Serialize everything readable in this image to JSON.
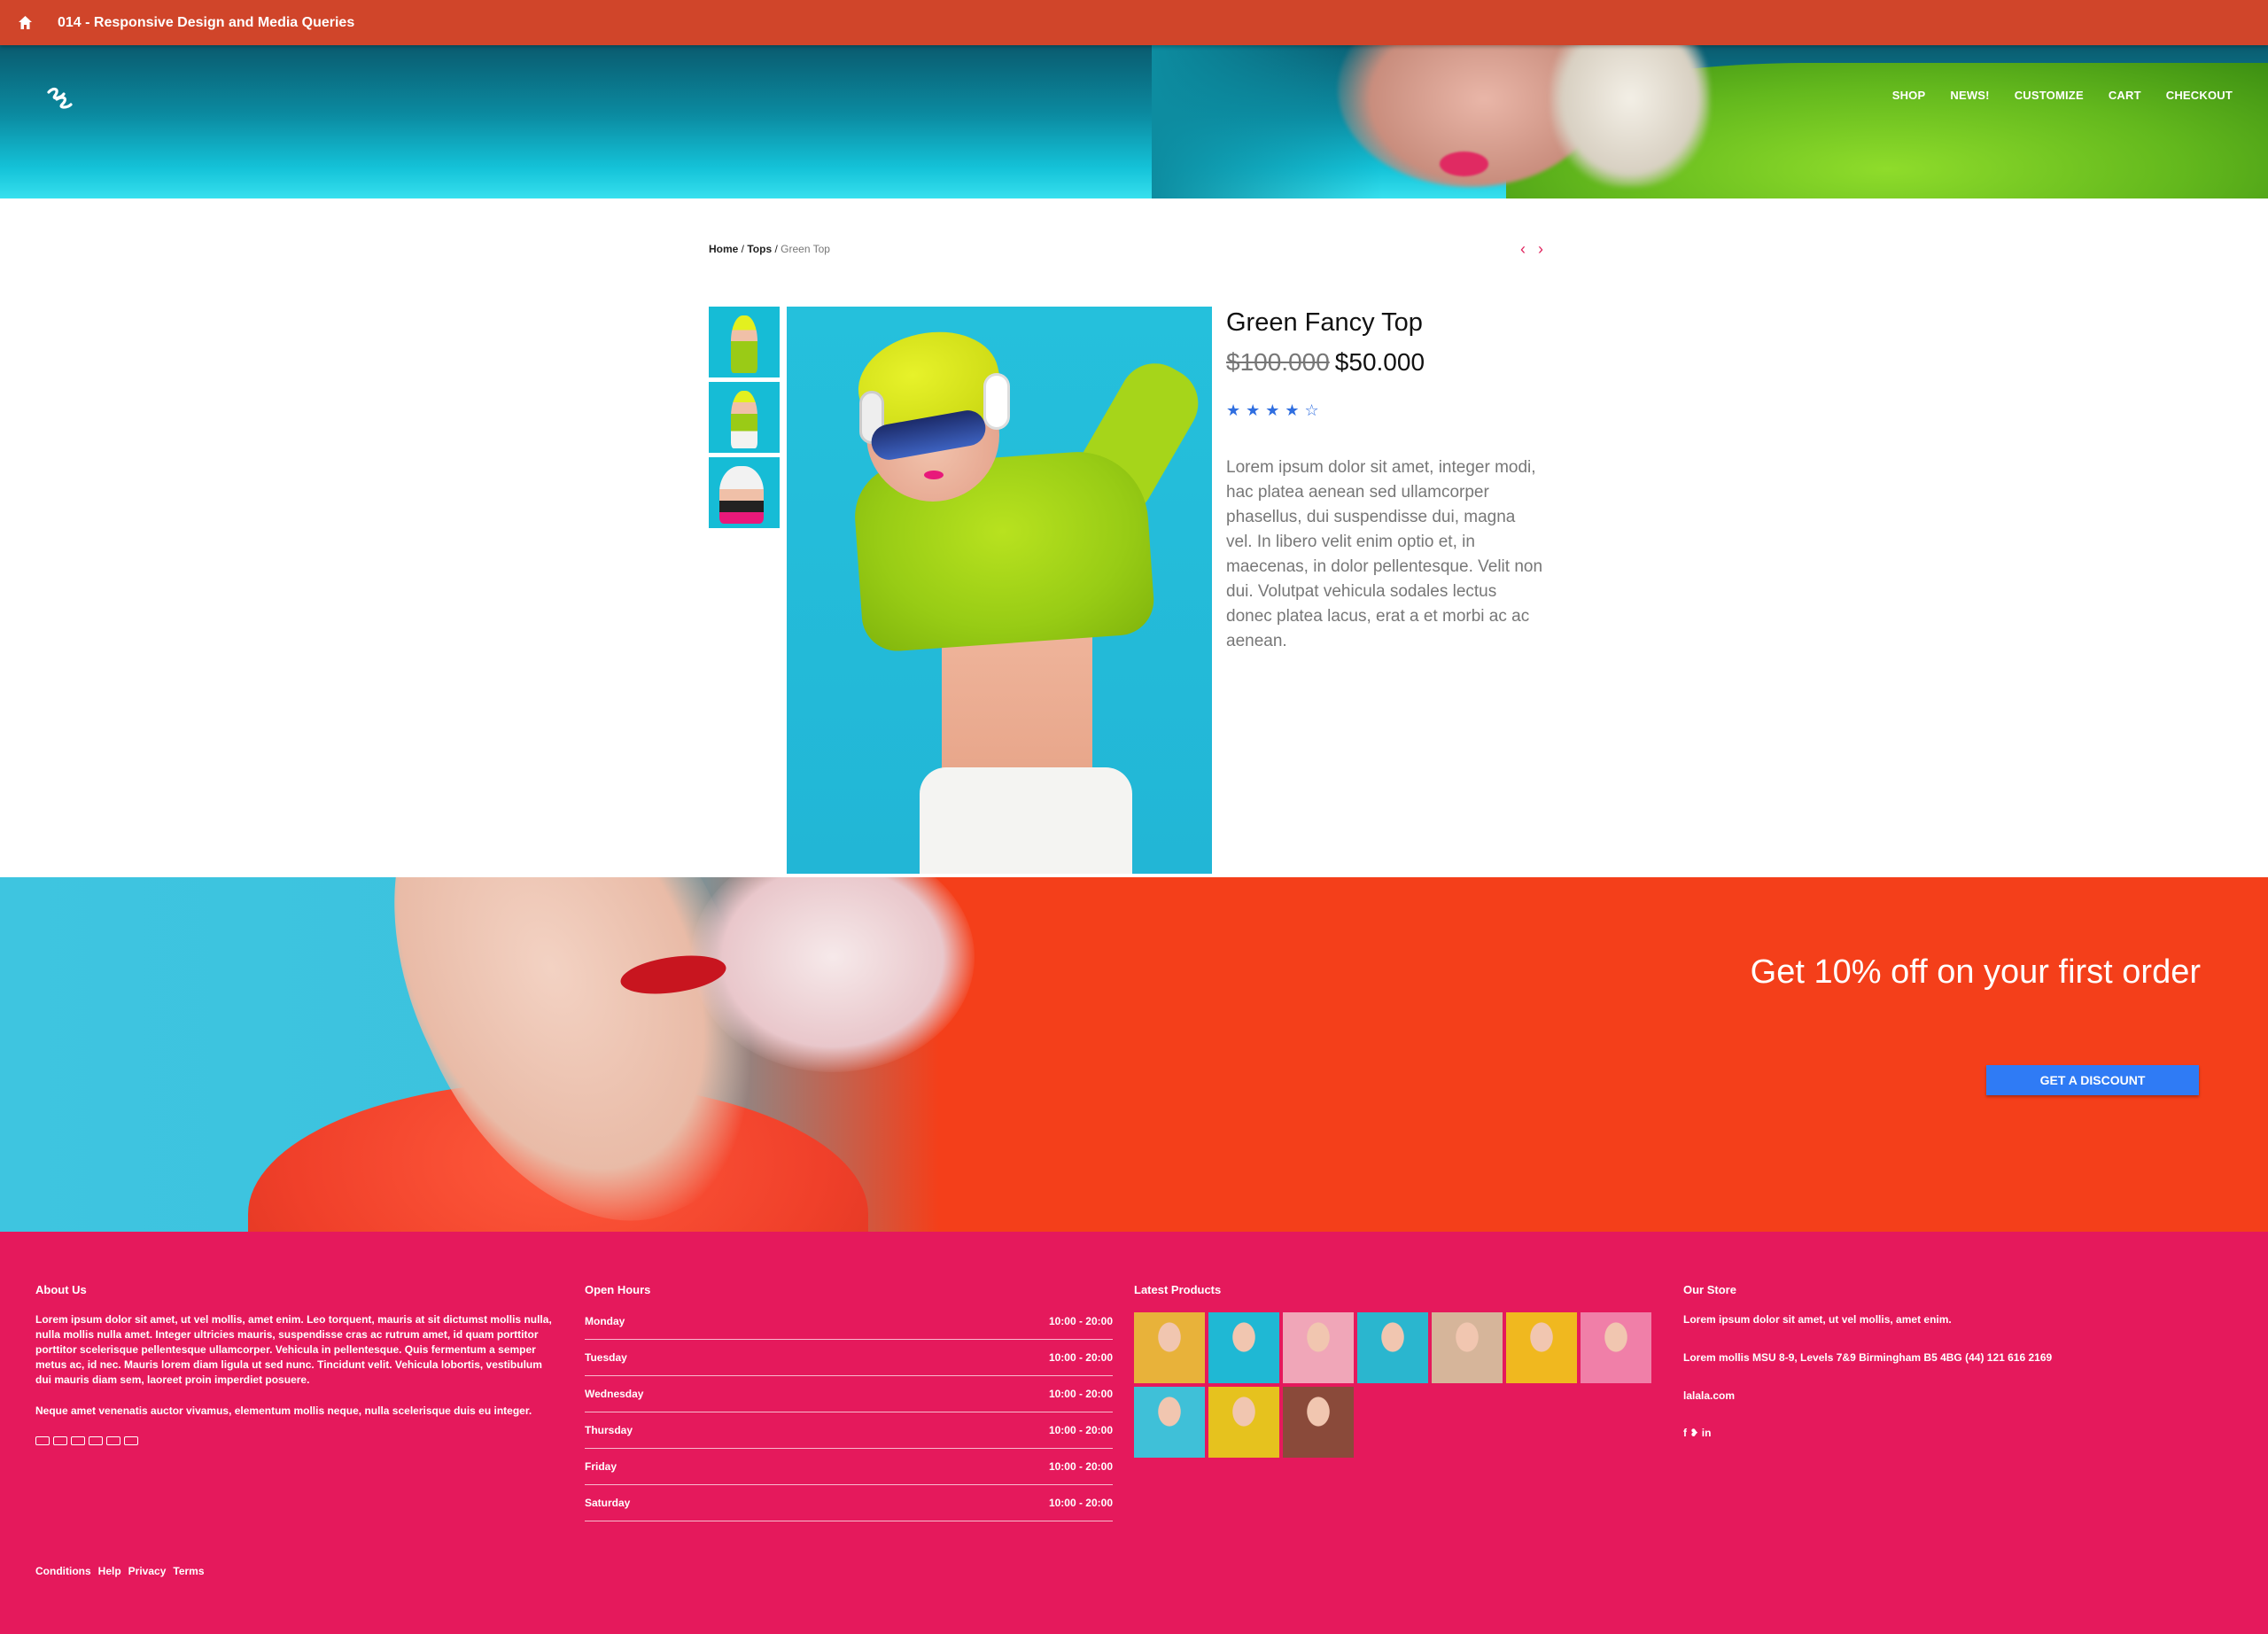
{
  "appbar": {
    "title": "014 - Responsive Design and Media Queries",
    "icon": "home-icon"
  },
  "header": {
    "logo": "script-s-logo",
    "nav": [
      "SHOP",
      "NEWS!",
      "CUSTOMIZE",
      "CART",
      "CHECKOUT"
    ]
  },
  "breadcrumb": {
    "home": "Home",
    "sep1": " / ",
    "category": "Tops",
    "sep2": " / ",
    "current": "Green Top"
  },
  "pager": {
    "prev": "‹",
    "next": "›"
  },
  "product": {
    "name": "Green Fancy Top",
    "old_price": "$100.000",
    "price": "$50.000",
    "rating": 4,
    "rating_max": 5,
    "stars_display": "★★★★☆",
    "description": "Lorem ipsum dolor sit amet, integer modi, hac platea aenean sed ullamcorper phasellus, dui suspendisse dui, magna vel. In libero velit enim optio et, in maecenas, in dolor pellentesque. Velit non dui. Volutpat vehicula sodales lectus donec platea lacus, erat a et morbi ac ac aenean."
  },
  "promo": {
    "headline": "Get 10% off on your first order",
    "cta": "GET A DISCOUNT",
    "accent": "#2f7bf5",
    "background": "#f43f1a"
  },
  "footer": {
    "background": "#e5195c",
    "about": {
      "title": "About Us",
      "p1": "Lorem ipsum dolor sit amet, ut vel mollis, amet enim. Leo torquent, mauris at sit dictumst mollis nulla, nulla mollis nulla amet. Integer ultricies mauris, suspendisse cras ac rutrum amet, id quam porttitor porttitor scelerisque pellentesque ullamcorper. Vehicula in pellentesque. Quis fermentum a semper metus ac, id nec. Mauris lorem diam ligula ut sed nunc. Tincidunt velit. Vehicula lobortis, vestibulum dui mauris diam sem, laoreet proin imperdiet posuere.",
      "p2": "Neque amet venenatis auctor vivamus, elementum mollis neque, nulla scelerisque duis eu integer."
    },
    "hours": {
      "title": "Open Hours",
      "rows": [
        {
          "day": "Monday",
          "time": "10:00 - 20:00"
        },
        {
          "day": "Tuesday",
          "time": "10:00 - 20:00"
        },
        {
          "day": "Wednesday",
          "time": "10:00 - 20:00"
        },
        {
          "day": "Thursday",
          "time": "10:00 - 20:00"
        },
        {
          "day": "Friday",
          "time": "10:00 - 20:00"
        },
        {
          "day": "Saturday",
          "time": "10:00 - 20:00"
        }
      ]
    },
    "latest": {
      "title": "Latest Products",
      "colors": [
        "#e8b23a",
        "#1fb8d4",
        "#f0a6b8",
        "#2ab6cf",
        "#d6b59a",
        "#f0b81f",
        "#f07fa8",
        "#3fc0d8",
        "#e6c21e",
        "#8a4a3a"
      ]
    },
    "store": {
      "title": "Our Store",
      "line1": "Lorem ipsum dolor sit amet, ut vel mollis, amet enim.",
      "line2": "Lorem mollis MSU 8-9, Levels 7&9 Birmingham B5 4BG (44) 121 616 2169",
      "line3": "lalala.com",
      "social": "f ♥ in"
    },
    "legal": [
      "Conditions",
      "Help",
      "Privacy",
      "Terms"
    ]
  }
}
